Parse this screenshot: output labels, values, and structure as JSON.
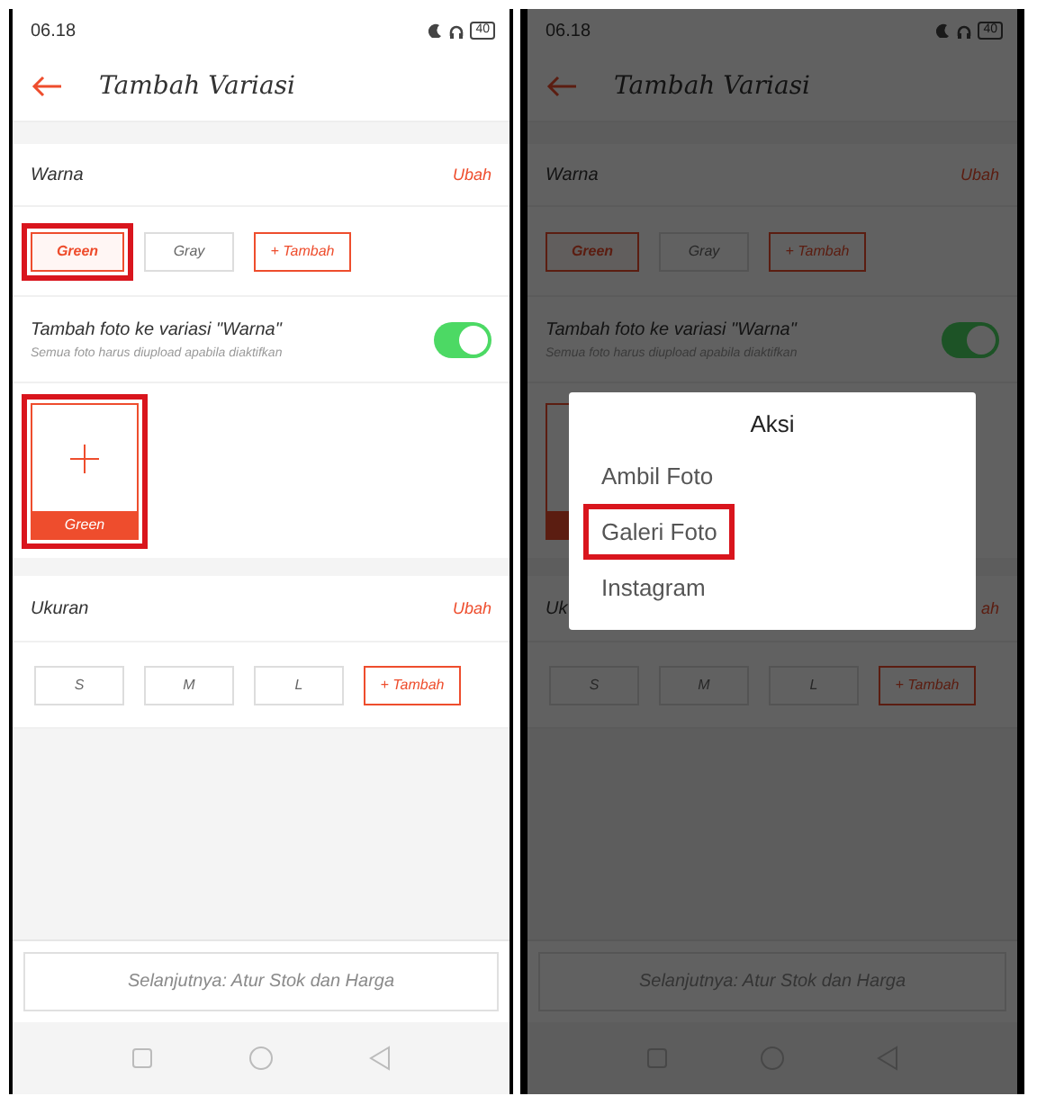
{
  "screens": [
    {
      "dimmed": false,
      "status_bar": {
        "time": "06.18",
        "battery": "40"
      },
      "title": "Tambah Variasi",
      "color_section": {
        "label": "Warna",
        "action": "Ubah",
        "options": [
          {
            "label": "Green",
            "kind": "option",
            "selected": true,
            "highlighted": true
          },
          {
            "label": "Gray",
            "kind": "option",
            "selected": false,
            "highlighted": false
          },
          {
            "label": "+ Tambah",
            "kind": "add",
            "highlighted": false
          }
        ]
      },
      "photo_toggle": {
        "title": "Tambah foto ke variasi \"Warna\"",
        "subtitle": "Semua foto harus diupload apabila diaktifkan",
        "on": true
      },
      "photo_tiles": [
        {
          "label": "Green",
          "highlighted": true
        }
      ],
      "size_section": {
        "label": "Ukuran",
        "action": "Ubah",
        "options": [
          {
            "label": "S",
            "kind": "option",
            "selected": false,
            "highlighted": false
          },
          {
            "label": "M",
            "kind": "option",
            "selected": false,
            "highlighted": false
          },
          {
            "label": "L",
            "kind": "option",
            "selected": false,
            "highlighted": false
          },
          {
            "label": "+ Tambah",
            "kind": "add",
            "highlighted": false
          }
        ]
      },
      "next_button": "Selanjutnya: Atur Stok dan Harga"
    },
    {
      "dimmed": true,
      "status_bar": {
        "time": "06.18",
        "battery": "40"
      },
      "title": "Tambah Variasi",
      "color_section": {
        "label": "Warna",
        "action": "Ubah",
        "options": [
          {
            "label": "Green",
            "kind": "option",
            "selected": true,
            "highlighted": false
          },
          {
            "label": "Gray",
            "kind": "option",
            "selected": false,
            "highlighted": false
          },
          {
            "label": "+ Tambah",
            "kind": "add",
            "highlighted": false
          }
        ]
      },
      "photo_toggle": {
        "title": "Tambah foto ke variasi \"Warna\"",
        "subtitle": "Semua foto harus diupload apabila diaktifkan",
        "on": true
      },
      "photo_tiles": [
        {
          "highlighted": false
        }
      ],
      "size_section": {
        "label": "Uk",
        "action": "ah",
        "options": [
          {
            "label": "S",
            "kind": "option",
            "selected": false,
            "highlighted": false
          },
          {
            "label": "M",
            "kind": "option",
            "selected": false,
            "highlighted": false
          },
          {
            "label": "L",
            "kind": "option",
            "selected": false,
            "highlighted": false
          },
          {
            "label": "+ Tambah",
            "kind": "add",
            "highlighted": false
          }
        ]
      },
      "next_button": "Selanjutnya: Atur Stok dan Harga",
      "dialog": {
        "title": "Aksi",
        "items": [
          {
            "label": "Ambil Foto",
            "highlighted": false
          },
          {
            "label": "Galeri Foto",
            "highlighted": true
          },
          {
            "label": "Instagram",
            "highlighted": false
          }
        ]
      }
    }
  ]
}
